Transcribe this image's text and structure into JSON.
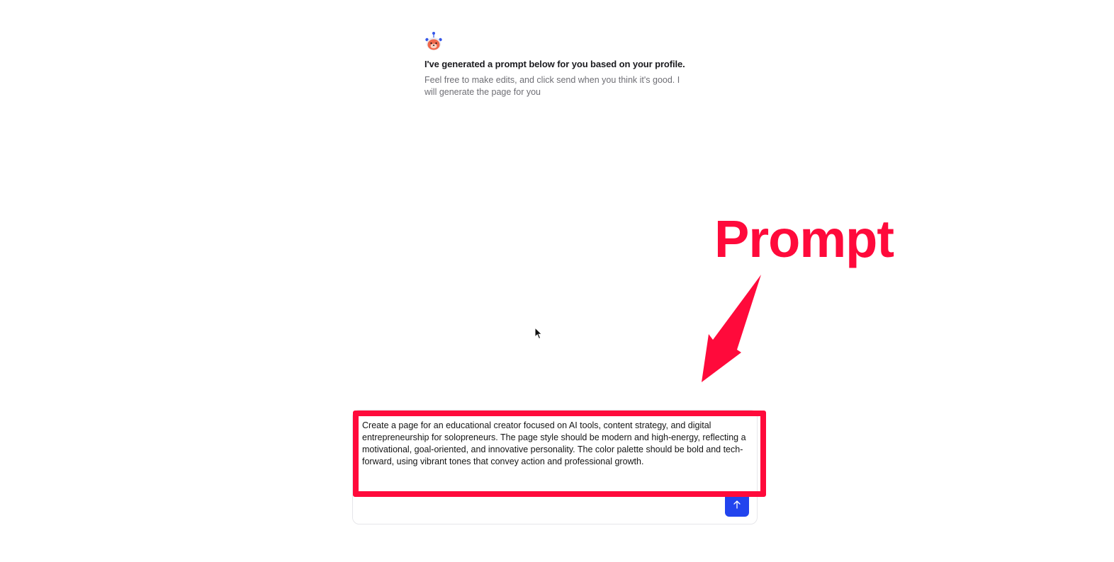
{
  "assistant": {
    "avatar_icon": "robot-bear-avatar",
    "title": "I've generated a prompt below for you based on your profile.",
    "body": "Feel free to make edits, and click send when you think it's good. I will generate the page for you"
  },
  "composer": {
    "prompt_value": "Create a page for an educational creator focused on AI tools, content strategy, and digital entrepreneurship for solopreneurs. The page style should be modern and high-energy, reflecting a motivational, goal-oriented, and innovative personality. The color palette should be bold and tech-forward, using vibrant tones that convey action and professional growth.",
    "send_icon": "arrow-up-icon",
    "send_color": "#2244ee"
  },
  "annotation": {
    "label": "Prompt",
    "color": "#ff0a3b",
    "arrow_icon": "arrow-down-left-icon"
  }
}
